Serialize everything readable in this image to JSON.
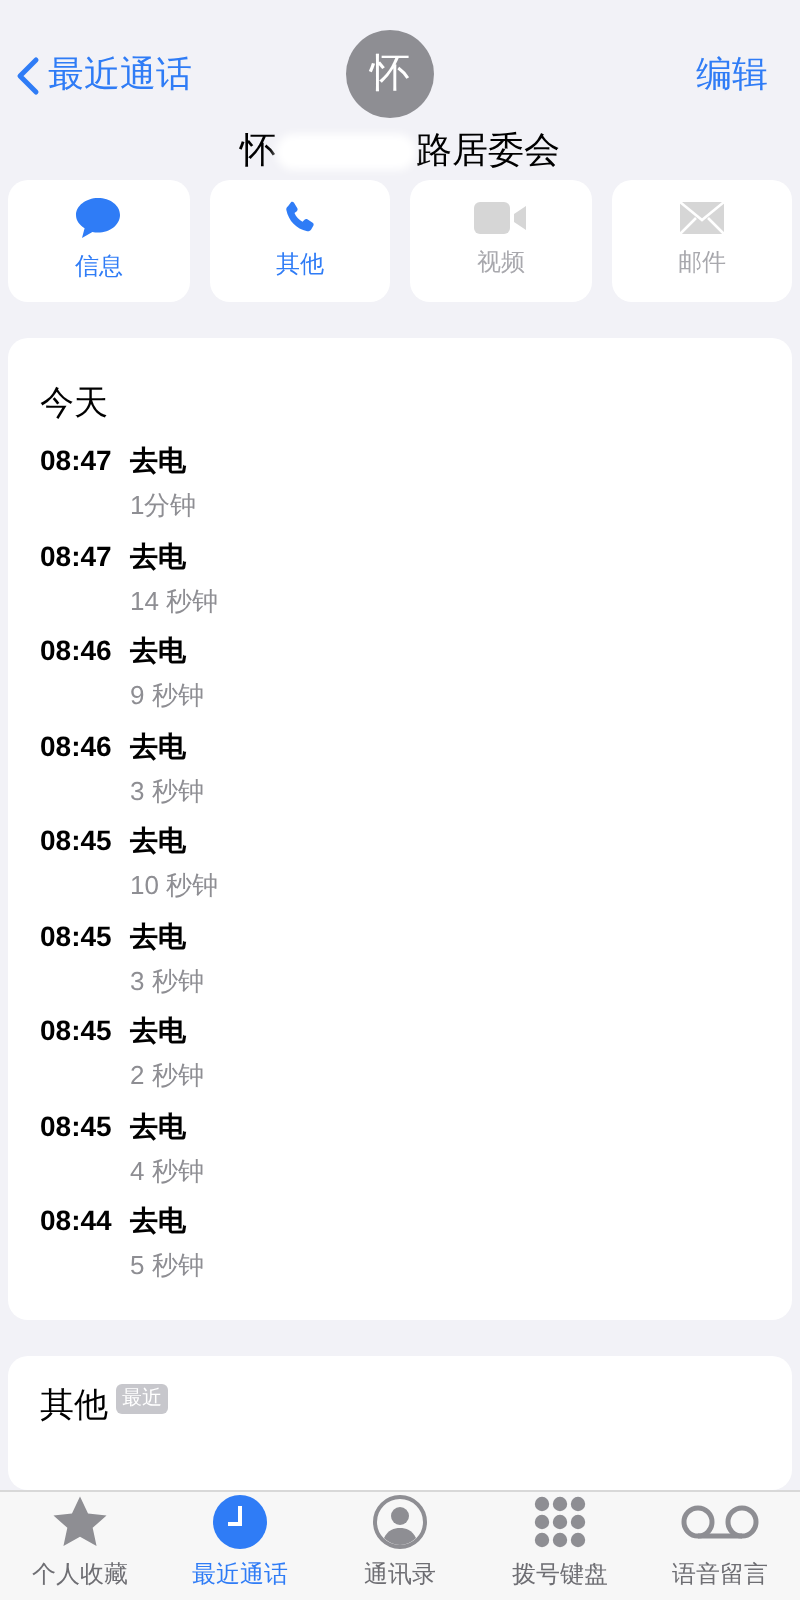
{
  "nav": {
    "back": "最近通话",
    "edit": "编辑"
  },
  "contact": {
    "avatar": "怀",
    "name_start": "怀",
    "name_end": "路居委会",
    "redacted": true
  },
  "actions": [
    {
      "kind": "message",
      "label": "信息",
      "disabled": false
    },
    {
      "kind": "phone",
      "label": "其他",
      "disabled": false
    },
    {
      "kind": "video",
      "label": "视频",
      "disabled": true
    },
    {
      "kind": "mail",
      "label": "邮件",
      "disabled": true
    }
  ],
  "calls": {
    "heading": "今天",
    "rows": [
      {
        "time": "08:47",
        "type": "去电",
        "duration": "1分钟"
      },
      {
        "time": "08:47",
        "type": "去电",
        "duration": "14 秒钟"
      },
      {
        "time": "08:46",
        "type": "去电",
        "duration": "9 秒钟"
      },
      {
        "time": "08:46",
        "type": "去电",
        "duration": "3 秒钟"
      },
      {
        "time": "08:45",
        "type": "去电",
        "duration": "10 秒钟"
      },
      {
        "time": "08:45",
        "type": "去电",
        "duration": "3 秒钟"
      },
      {
        "time": "08:45",
        "type": "去电",
        "duration": "2 秒钟"
      },
      {
        "time": "08:45",
        "type": "去电",
        "duration": "4 秒钟"
      },
      {
        "time": "08:44",
        "type": "去电",
        "duration": "5 秒钟"
      }
    ]
  },
  "other": {
    "heading": "其他",
    "badge": "最近"
  },
  "tabs": [
    {
      "kind": "star",
      "label": "个人收藏",
      "selected": false
    },
    {
      "kind": "clock",
      "label": "最近通话",
      "selected": true
    },
    {
      "kind": "person",
      "label": "通讯录",
      "selected": false
    },
    {
      "kind": "keypad",
      "label": "拨号键盘",
      "selected": false
    },
    {
      "kind": "voicemail",
      "label": "语音留言",
      "selected": false
    }
  ]
}
